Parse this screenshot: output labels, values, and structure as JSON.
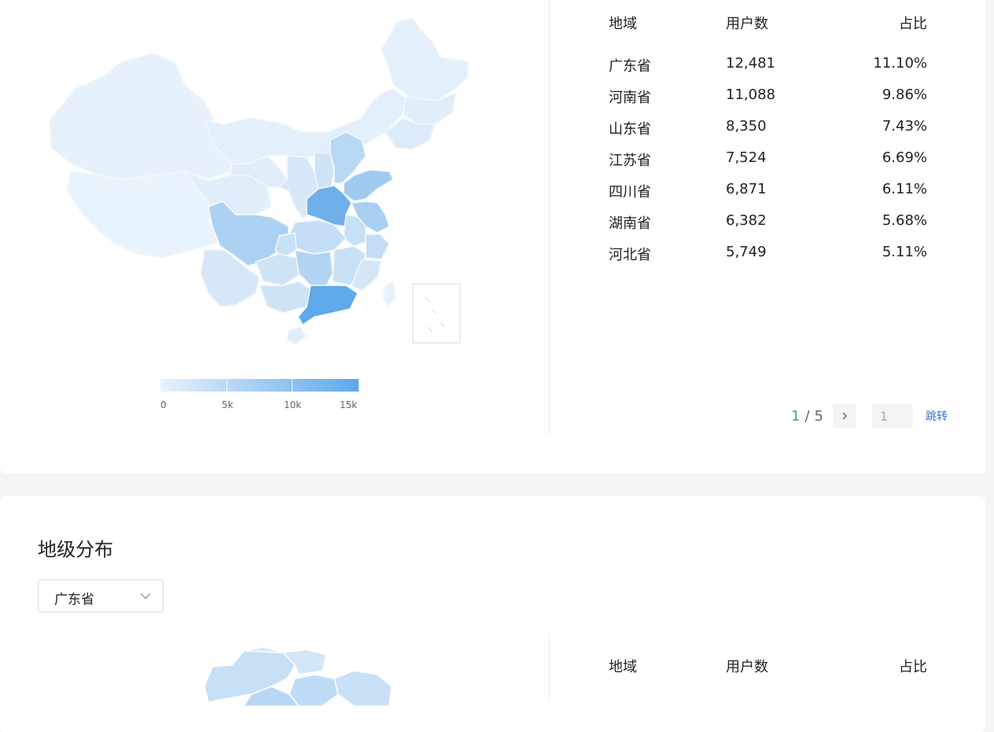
{
  "provinces_map": {
    "legend": {
      "labels": [
        "0",
        "5k",
        "10k",
        "15k"
      ],
      "min_color": "#e8f3fd",
      "max_color": "#5ea9ea"
    }
  },
  "province_table": {
    "headers": {
      "region": "地域",
      "users": "用户数",
      "ratio": "占比"
    },
    "rows": [
      {
        "region": "广东省",
        "users": "12,481",
        "ratio": "11.10%"
      },
      {
        "region": "河南省",
        "users": "11,088",
        "ratio": "9.86%"
      },
      {
        "region": "山东省",
        "users": "8,350",
        "ratio": "7.43%"
      },
      {
        "region": "江苏省",
        "users": "7,524",
        "ratio": "6.69%"
      },
      {
        "region": "四川省",
        "users": "6,871",
        "ratio": "6.11%"
      },
      {
        "region": "湖南省",
        "users": "6,382",
        "ratio": "5.68%"
      },
      {
        "region": "河北省",
        "users": "5,749",
        "ratio": "5.11%"
      }
    ]
  },
  "pagination": {
    "current": "1",
    "separator": "/",
    "total": "5",
    "jump_value": "1",
    "jump_label": "跳转",
    "next_icon": "chevron-right-icon"
  },
  "city_section": {
    "title": "地级分布",
    "select": {
      "value": "广东省",
      "icon": "chevron-down-icon"
    },
    "table_headers": {
      "region": "地域",
      "users": "用户数",
      "ratio": "占比"
    }
  },
  "colors": {
    "accent_green": "#2fb463",
    "link_blue": "#3c6ad4"
  }
}
